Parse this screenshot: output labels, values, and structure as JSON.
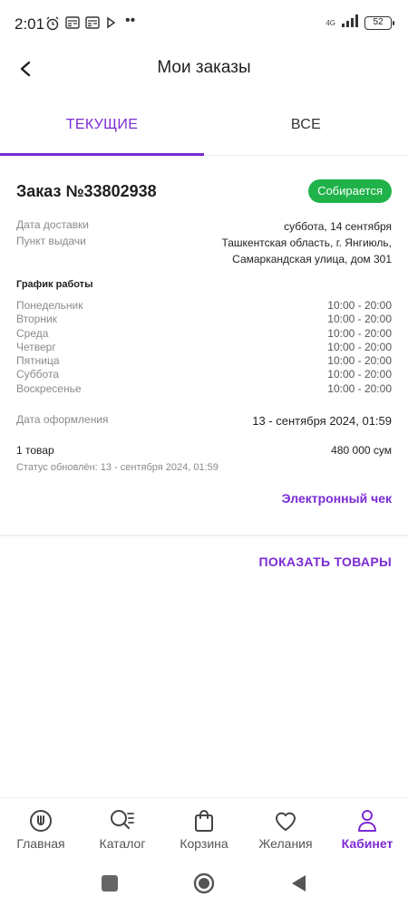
{
  "status_bar": {
    "time": "2:01",
    "network": "4G",
    "battery": "52"
  },
  "header": {
    "title": "Мои заказы"
  },
  "tabs": [
    {
      "label": "ТЕКУЩИЕ",
      "active": true
    },
    {
      "label": "ВСЕ",
      "active": false
    }
  ],
  "order": {
    "title": "Заказ №33802938",
    "status": "Собирается",
    "delivery_date_label": "Дата доставки",
    "delivery_date": "суббота, 14 сентября",
    "pickup_label": "Пункт выдачи",
    "pickup_line1": "Ташкентская область, г. Янгиюль,",
    "pickup_line2": "Самаркандская улица, дом 301",
    "schedule_title": "График работы",
    "schedule": [
      {
        "day": "Понедельник",
        "hours": "10:00 - 20:00"
      },
      {
        "day": "Вторник",
        "hours": "10:00 - 20:00"
      },
      {
        "day": "Среда",
        "hours": "10:00 - 20:00"
      },
      {
        "day": "Четверг",
        "hours": "10:00 - 20:00"
      },
      {
        "day": "Пятница",
        "hours": "10:00 - 20:00"
      },
      {
        "day": "Суббота",
        "hours": "10:00 - 20:00"
      },
      {
        "day": "Воскресенье",
        "hours": "10:00 - 20:00"
      }
    ],
    "created_label": "Дата оформления",
    "created": "13 - сентября 2024, 01:59",
    "items_count": "1 товар",
    "items_price": "480 000 сум",
    "status_updated": "Статус обновлён: 13 - сентября 2024, 01:59",
    "receipt_link": "Электронный чек",
    "show_goods": "ПОКАЗАТЬ ТОВАРЫ"
  },
  "bottom_nav": [
    {
      "label": "Главная",
      "icon": "home-icon",
      "active": false
    },
    {
      "label": "Каталог",
      "icon": "catalog-search-icon",
      "active": false
    },
    {
      "label": "Корзина",
      "icon": "bag-icon",
      "active": false
    },
    {
      "label": "Желания",
      "icon": "heart-icon",
      "active": false
    },
    {
      "label": "Кабинет",
      "icon": "user-icon",
      "active": true
    }
  ],
  "colors": {
    "accent": "#7b2bd4",
    "status_green": "#1fb248"
  }
}
